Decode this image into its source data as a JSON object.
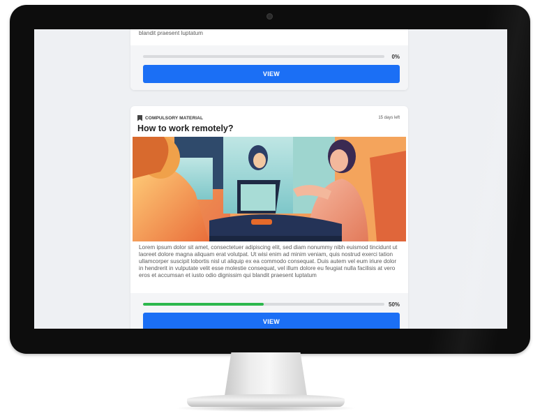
{
  "top_card": {
    "description": "blandit praesent luptatum",
    "progress": {
      "value": 0,
      "label": "0%"
    },
    "button_label": "VIEW"
  },
  "main_card": {
    "tag": "COMPULSORY MATERIAL",
    "due": "15 days left",
    "title": "How to work remotely?",
    "description": "Lorem ipsum dolor sit amet, consectetuer adipiscing elit, sed diam nonummy nibh euismod tincidunt ut laoreet dolore magna aliquam erat volutpat. Ut wisi enim ad minim veniam, quis nostrud exerci tation ullamcorper suscipit lobortis nisl ut aliquip ex ea commodo consequat. Duis autem vel eum iriure dolor in hendrerit in vulputate velit esse molestie consequat, vel illum dolore eu feugiat nulla facilisis at vero eros et accumsan et iusto odio dignissim qui blandit praesent luptatum",
    "progress": {
      "value": 0.5,
      "label": "50%"
    },
    "button_label": "VIEW"
  },
  "colors": {
    "accent": "#1b6ff5",
    "progress_fill": "#2db84d",
    "page_bg": "#eef0f3"
  },
  "icons": {
    "tag_icon": "bookmark-icon"
  }
}
